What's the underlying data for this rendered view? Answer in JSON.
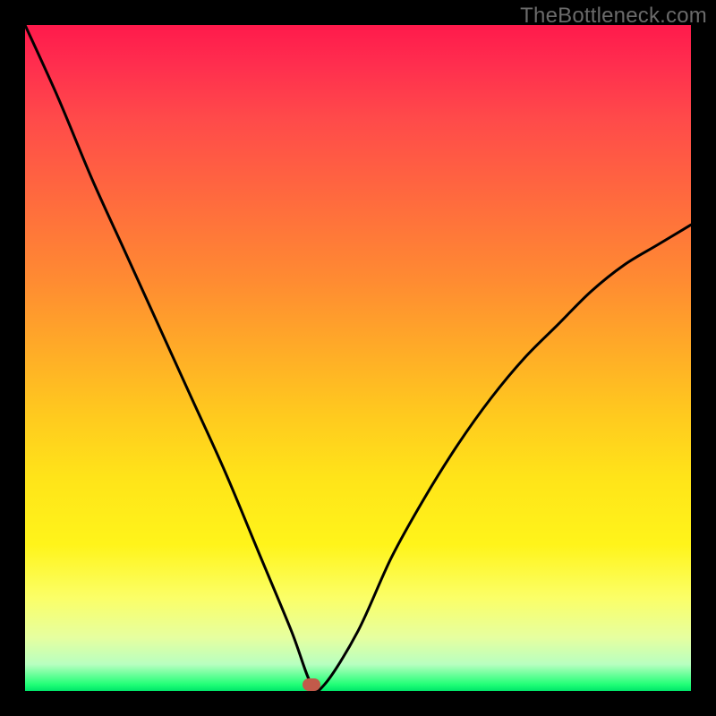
{
  "watermark": "TheBottleneck.com",
  "colors": {
    "frame": "#000000",
    "curve": "#000000",
    "marker": "#c25a4a"
  },
  "chart_data": {
    "type": "line",
    "title": "",
    "xlabel": "",
    "ylabel": "",
    "xlim": [
      0,
      100
    ],
    "ylim": [
      0,
      100
    ],
    "grid": false,
    "legend": false,
    "annotations": [
      {
        "name": "marker",
        "x": 43,
        "y": 1
      }
    ],
    "series": [
      {
        "name": "bottleneck-curve",
        "x": [
          0,
          5,
          10,
          15,
          20,
          25,
          30,
          35,
          40,
          43,
          45,
          50,
          55,
          60,
          65,
          70,
          75,
          80,
          85,
          90,
          95,
          100
        ],
        "y": [
          100,
          89,
          77,
          66,
          55,
          44,
          33,
          21,
          9,
          1,
          1,
          9,
          20,
          29,
          37,
          44,
          50,
          55,
          60,
          64,
          67,
          70
        ]
      }
    ]
  }
}
